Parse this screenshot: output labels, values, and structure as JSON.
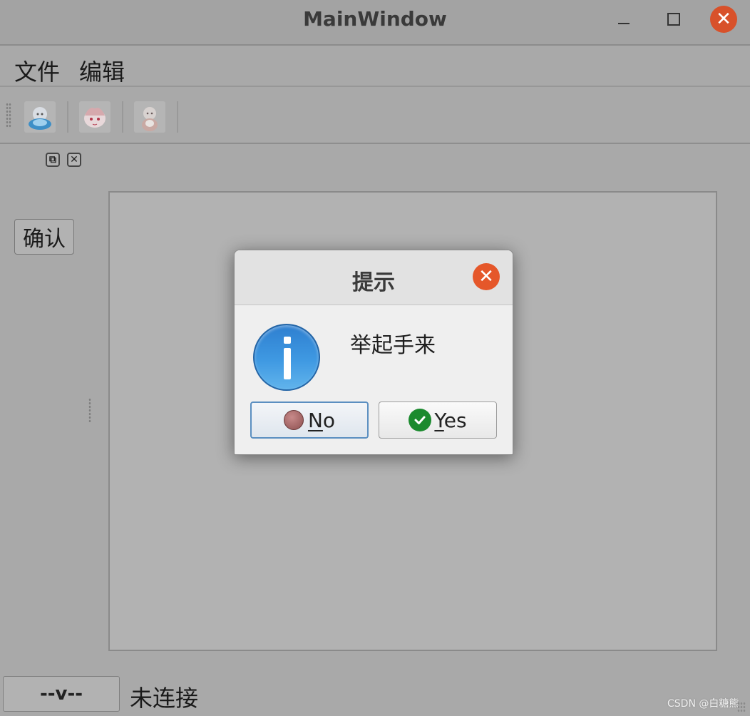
{
  "window": {
    "title": "MainWindow"
  },
  "menubar": {
    "items": [
      {
        "label": "文件"
      },
      {
        "label": "编辑"
      }
    ]
  },
  "toolbar": {
    "buttons": [
      {
        "icon": "avatar-blue-icon"
      },
      {
        "icon": "avatar-pink-icon"
      },
      {
        "icon": "avatar-gray-icon"
      }
    ]
  },
  "sidebar": {
    "confirm_label": "确认"
  },
  "bottom": {
    "combo_label": "--v--",
    "status_text": "未连接",
    "watermark": "CSDN @白糖熊"
  },
  "dialog": {
    "title": "提示",
    "message": "举起手来",
    "no_button": {
      "mnemonic": "N",
      "rest": "o"
    },
    "yes_button": {
      "mnemonic": "Y",
      "rest": "es"
    },
    "icon": "information-icon"
  },
  "colors": {
    "close_button": "#e5572a",
    "info_blue": "#3f99e2",
    "yes_green": "#1b8a2e"
  }
}
